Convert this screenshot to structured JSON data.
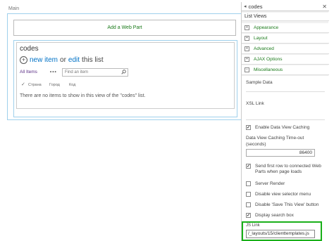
{
  "zone": {
    "label": "Main",
    "add_webpart": "Add a Web Part"
  },
  "webpart": {
    "title": "codes",
    "new_item": "new item",
    "or": "or",
    "edit": "edit",
    "this_list": "this list",
    "all_items": "All Items",
    "ellipsis": "•••",
    "search_placeholder": "Find an item",
    "columns": [
      "Страна",
      "Город",
      "Код"
    ],
    "empty_message": "There are no items to show in this view of the \"codes\" list."
  },
  "panel": {
    "title": "codes",
    "section": "List Views",
    "categories": [
      {
        "label": "Appearance",
        "state": "+"
      },
      {
        "label": "Layout",
        "state": "+"
      },
      {
        "label": "Advanced",
        "state": "+"
      },
      {
        "label": "AJAX Options",
        "state": "+"
      },
      {
        "label": "Miscellaneous",
        "state": "−"
      }
    ],
    "sample_data": "Sample Data",
    "xsl_link": "XSL Link",
    "enable_caching": "Enable Data View Caching",
    "caching_timeout_label": "Data View Caching Time-out (seconds)",
    "caching_timeout_value": "86400",
    "send_first_row": "Send first row to connected Web Parts when page loads",
    "server_render": "Server Render",
    "disable_view_selector": "Disable view selector menu",
    "disable_save_view": "Disable 'Save This View' button",
    "display_search_box": "Display search box",
    "js_link_label": "JS Link",
    "js_link_value": "/_layouts/15/clienttemplates.js"
  },
  "colors": {
    "accent": "#0072c6",
    "category": "#1a7a1a",
    "highlight": "#19b019"
  }
}
